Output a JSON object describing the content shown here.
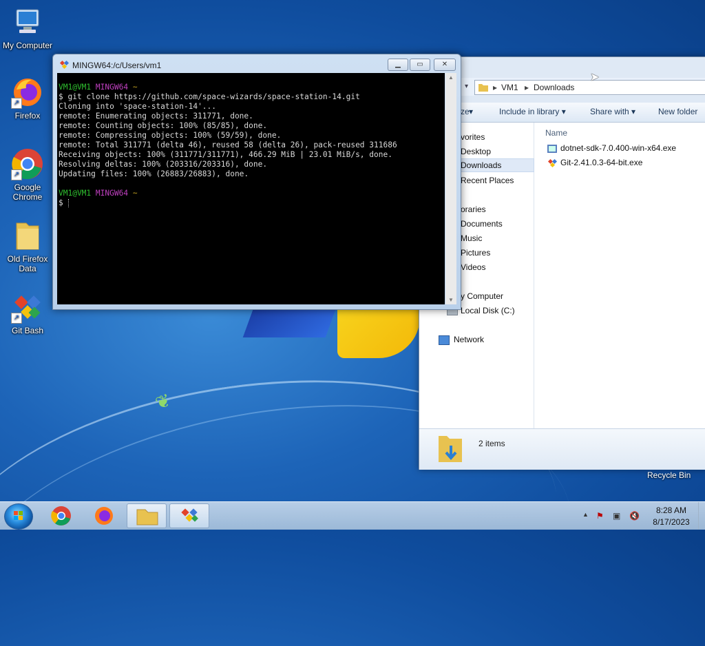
{
  "desktop": {
    "icons": [
      {
        "label": "My Computer",
        "icon": "computer-icon"
      },
      {
        "label": "Firefox",
        "icon": "firefox-icon"
      },
      {
        "label": "Google Chrome",
        "icon": "chrome-icon"
      },
      {
        "label": "Old Firefox Data",
        "icon": "folder-icon"
      },
      {
        "label": "Git Bash",
        "icon": "git-bash-icon"
      }
    ],
    "recycle_bin_label": "Recycle Bin"
  },
  "terminal": {
    "title": "MINGW64:/c/Users/vm1",
    "prompt_user": "VM1@VM1",
    "prompt_env": "MINGW64",
    "prompt_path": "~",
    "command": "$ git clone https://github.com/space-wizards/space-station-14.git",
    "output": [
      "Cloning into 'space-station-14'...",
      "remote: Enumerating objects: 311771, done.",
      "remote: Counting objects: 100% (85/85), done.",
      "remote: Compressing objects: 100% (59/59), done.",
      "remote: Total 311771 (delta 46), reused 58 (delta 26), pack-reused 311686",
      "Receiving objects: 100% (311771/311771), 466.29 MiB | 23.01 MiB/s, done.",
      "Resolving deltas: 100% (203316/203316), done.",
      "Updating files: 100% (26883/26883), done."
    ],
    "final_prompt": "$"
  },
  "explorer": {
    "breadcrumb": [
      "VM1",
      "Downloads"
    ],
    "toolbar": {
      "organize_partial": "ze",
      "include_label": "Include in library",
      "share_label": "Share with",
      "new_folder_label": "New folder"
    },
    "nav": {
      "favorites": "vorites",
      "desktop": "Desktop",
      "downloads": "Downloads",
      "recent": "Recent Places",
      "libraries": "oraries",
      "documents": "Documents",
      "music": "Music",
      "pictures": "Pictures",
      "videos": "Videos",
      "computer": "y Computer",
      "local_disk": "Local Disk (C:)",
      "network": "Network"
    },
    "column_name": "Name",
    "files": [
      {
        "name": "dotnet-sdk-7.0.400-win-x64.exe",
        "icon": "installer-icon"
      },
      {
        "name": "Git-2.41.0.3-64-bit.exe",
        "icon": "git-installer-icon"
      }
    ],
    "status": "2 items"
  },
  "taskbar": {
    "time": "8:28 AM",
    "date": "8/17/2023"
  }
}
